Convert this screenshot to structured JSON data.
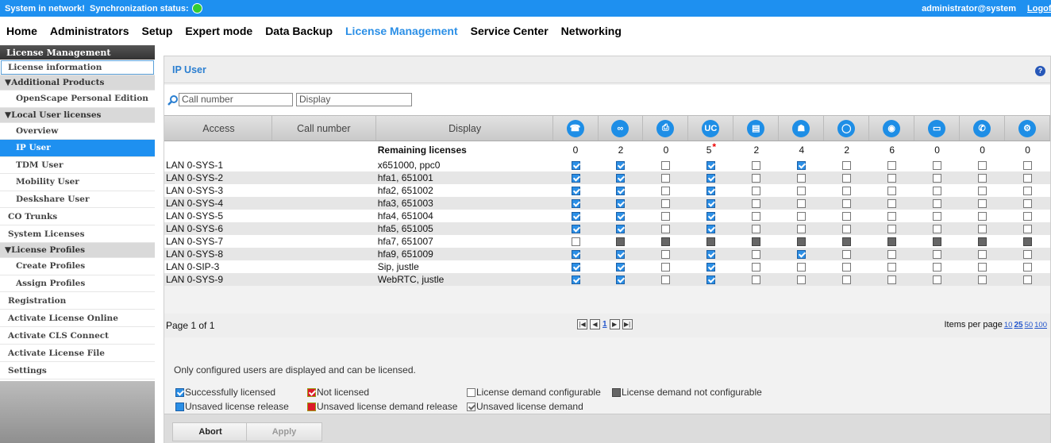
{
  "topbar": {
    "status": "System in network!",
    "sync": "Synchronization status:",
    "user": "administrator@system",
    "logoff": "Logoff"
  },
  "menu": [
    "Home",
    "Administrators",
    "Setup",
    "Expert mode",
    "Data Backup",
    "License Management",
    "Service Center",
    "Networking"
  ],
  "menu_active": "License Management",
  "sidebar": {
    "header": "License Management",
    "items": [
      {
        "label": "License information",
        "kind": "l1",
        "box": true
      },
      {
        "label": "▼Additional Products",
        "kind": "group"
      },
      {
        "label": "OpenScape Personal Edition",
        "kind": "l2"
      },
      {
        "label": "▼Local User licenses",
        "kind": "group"
      },
      {
        "label": "Overview",
        "kind": "l2"
      },
      {
        "label": "IP User",
        "kind": "l2",
        "selected": true
      },
      {
        "label": "TDM User",
        "kind": "l2"
      },
      {
        "label": "Mobility User",
        "kind": "l2"
      },
      {
        "label": "Deskshare User",
        "kind": "l2"
      },
      {
        "label": "CO Trunks",
        "kind": "l0"
      },
      {
        "label": "System Licenses",
        "kind": "l0"
      },
      {
        "label": "▼License Profiles",
        "kind": "group"
      },
      {
        "label": "Create Profiles",
        "kind": "l2"
      },
      {
        "label": "Assign Profiles",
        "kind": "l2"
      },
      {
        "label": "Registration",
        "kind": "l0"
      },
      {
        "label": "Activate License Online",
        "kind": "l0"
      },
      {
        "label": "Activate CLS Connect",
        "kind": "l0"
      },
      {
        "label": "Activate License File",
        "kind": "l0"
      },
      {
        "label": "Settings",
        "kind": "l0"
      }
    ]
  },
  "panel": {
    "title": "IP User",
    "help": "?"
  },
  "filters": {
    "call_placeholder": "Call number",
    "display_placeholder": "Display"
  },
  "table": {
    "headers": {
      "access": "Access",
      "call": "Call number",
      "display": "Display"
    },
    "license_icons": [
      "user-phone-icon",
      "voicemail-icon",
      "fax-icon",
      "uc-user-icon",
      "printer-icon",
      "conference-icon",
      "headset-icon",
      "agent-icon",
      "desk-icon",
      "mobile-icon",
      "settings-icon"
    ],
    "remaining_label": "Remaining licenses",
    "remaining": [
      "0",
      "2",
      "0",
      "5",
      "2",
      "4",
      "2",
      "6",
      "0",
      "0",
      "0"
    ],
    "remaining_star_index": 3,
    "rows": [
      {
        "access": "LAN 0-SYS-1",
        "call": "",
        "display": "x651000, ppc0",
        "states": "11010100000"
      },
      {
        "access": "LAN 0-SYS-2",
        "call": "",
        "display": "hfa1, 651001",
        "states": "11010000000"
      },
      {
        "access": "LAN 0-SYS-3",
        "call": "",
        "display": "hfa2, 651002",
        "states": "11010000000"
      },
      {
        "access": "LAN 0-SYS-4",
        "call": "",
        "display": "hfa3, 651003",
        "states": "11010000000"
      },
      {
        "access": "LAN 0-SYS-5",
        "call": "",
        "display": "hfa4, 651004",
        "states": "11010000000"
      },
      {
        "access": "LAN 0-SYS-6",
        "call": "",
        "display": "hfa5, 651005",
        "states": "11010000000"
      },
      {
        "access": "LAN 0-SYS-7",
        "call": "",
        "display": "hfa7, 651007",
        "states": "0dddddddddd"
      },
      {
        "access": "LAN 0-SYS-8",
        "call": "",
        "display": "hfa9, 651009",
        "states": "11010100000"
      },
      {
        "access": "LAN 0-SIP-3",
        "call": "",
        "display": "Sip, justle",
        "states": "11010000000"
      },
      {
        "access": "LAN 0-SYS-9",
        "call": "",
        "display": "WebRTC, justle",
        "states": "11010000000"
      }
    ]
  },
  "pager": {
    "text": "Page 1 of 1",
    "page": "1",
    "ipp_label": "Items per page",
    "ipp": [
      "10",
      "25",
      "50",
      "100"
    ],
    "ipp_current": "25"
  },
  "note": "Only configured users are displayed and can be licensed.",
  "legend": [
    {
      "label": "Successfully licensed",
      "style": "blue chk"
    },
    {
      "label": "Not licensed",
      "style": "red chk"
    },
    {
      "label": "License demand configurable",
      "style": "white"
    },
    {
      "label": "License demand not configurable",
      "style": "grey"
    },
    {
      "label": "Unsaved license release",
      "style": "blue"
    },
    {
      "label": "Unsaved license demand release",
      "style": "red"
    },
    {
      "label": "Unsaved license demand",
      "style": "white chkg"
    }
  ],
  "buttons": {
    "abort": "Abort",
    "apply": "Apply"
  }
}
